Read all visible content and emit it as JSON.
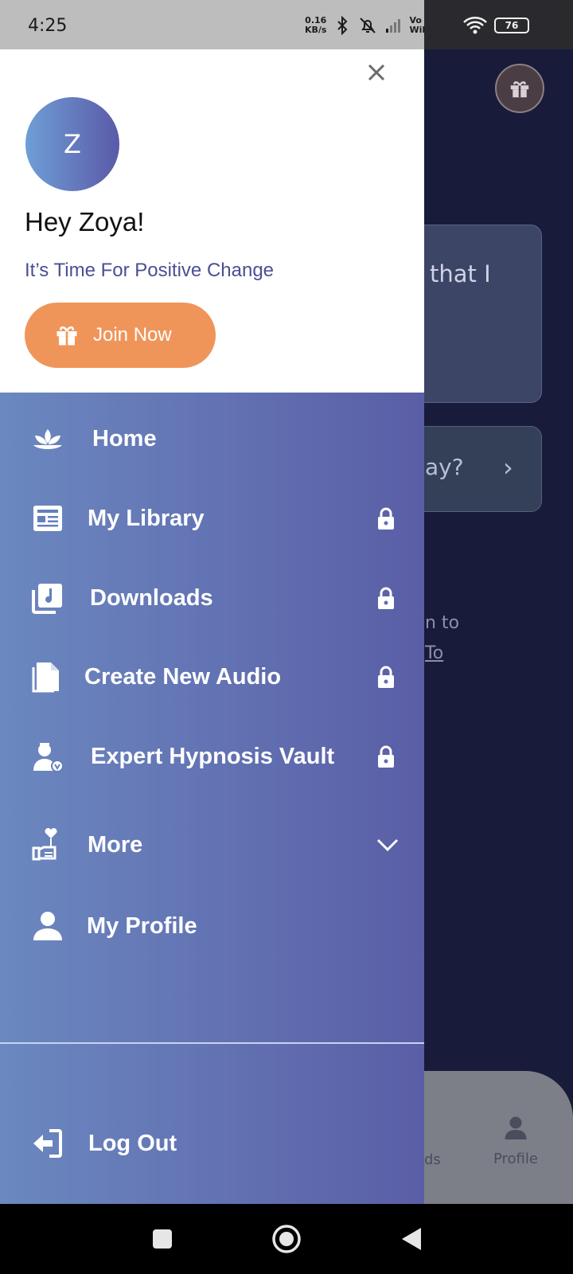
{
  "status_bar": {
    "time": "4:25",
    "speed_value": "0.16",
    "speed_unit": "KB/s",
    "volte_top": "Vo",
    "volte_bottom": "WiFi",
    "battery": "76",
    "icons": [
      "bluetooth-icon",
      "bell-off-icon",
      "signal-icon",
      "wifi-icon",
      "battery-icon"
    ]
  },
  "drawer": {
    "avatar_initial": "Z",
    "greeting": "Hey Zoya!",
    "tagline": "It’s Time For Positive Change",
    "join_label": "Join Now",
    "menu": [
      {
        "label": "Home",
        "icon": "lotus-icon",
        "locked": false
      },
      {
        "label": "My Library",
        "icon": "library-icon",
        "locked": true
      },
      {
        "label": "Downloads",
        "icon": "music-downloads-icon",
        "locked": true
      },
      {
        "label": "Create New Audio",
        "icon": "document-icon",
        "locked": true
      },
      {
        "label": "Expert Hypnosis Vault",
        "icon": "expert-icon",
        "locked": true
      },
      {
        "label": "More",
        "icon": "heart-hand-icon",
        "expandable": true
      },
      {
        "label": "My Profile",
        "icon": "person-icon",
        "locked": false
      }
    ],
    "logout_label": "Log Out"
  },
  "background": {
    "card1_text": "that I",
    "card2_text": "ay?",
    "line1": "n to",
    "line2": "To",
    "nav_partial": "ds",
    "nav_profile": "Profile"
  },
  "colors": {
    "accent_orange": "#f0955a",
    "menu_gradient_start": "#6b88c0",
    "menu_gradient_end": "#5a5ea6",
    "tagline": "#4b4f92"
  }
}
